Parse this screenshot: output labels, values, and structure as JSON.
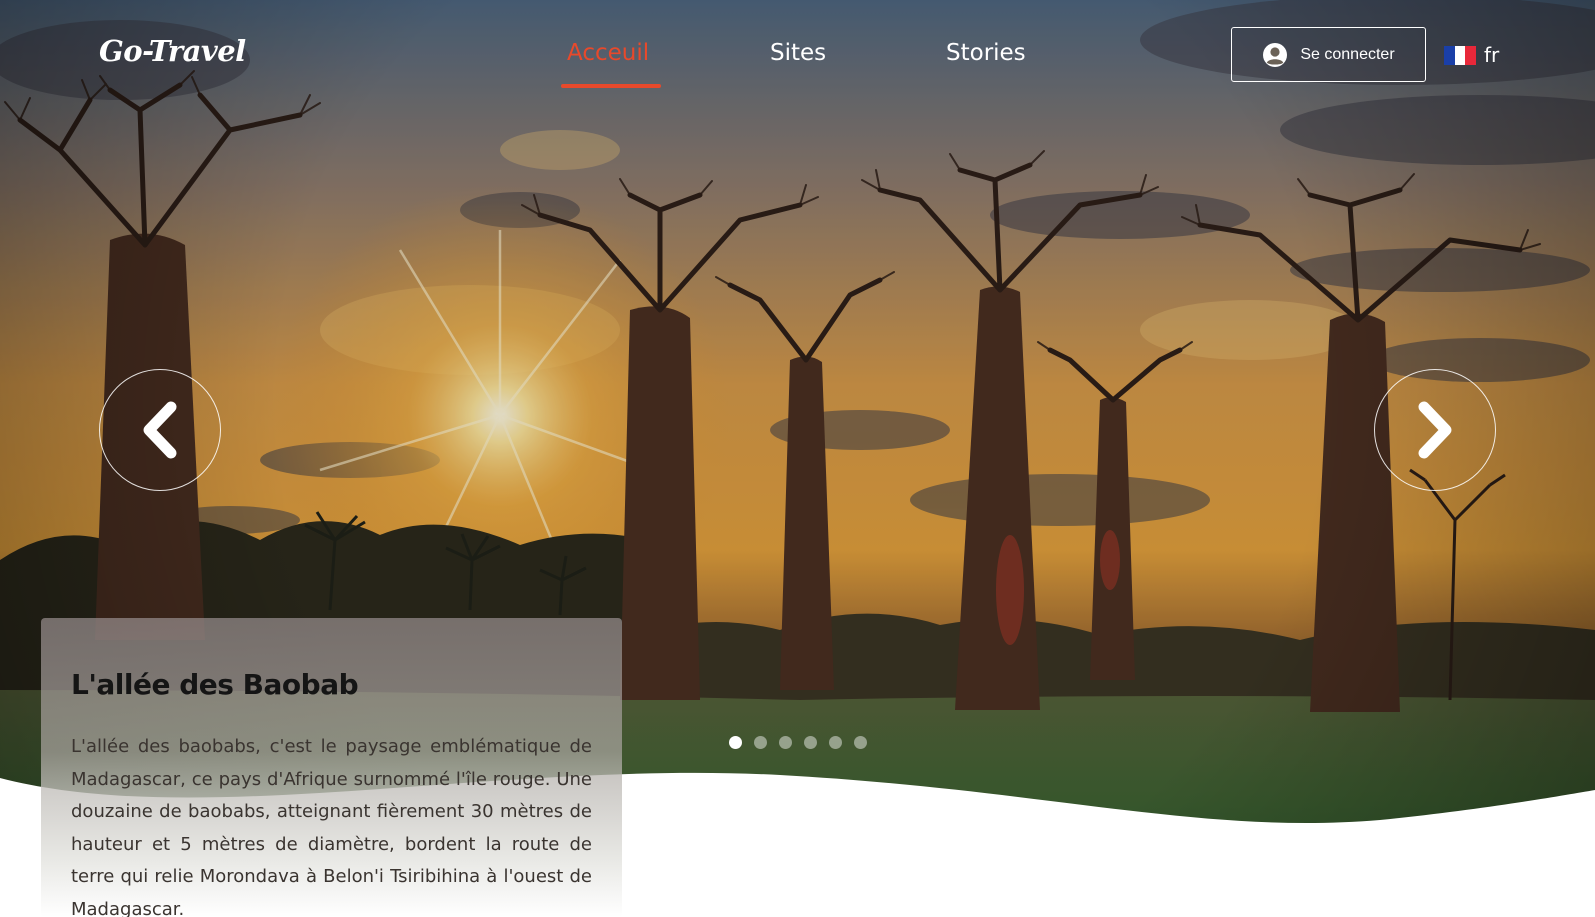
{
  "brand": {
    "logo_text": "Go-Travel"
  },
  "nav": {
    "items": [
      {
        "label": "Acceuil",
        "active": true
      },
      {
        "label": "Sites",
        "active": false
      },
      {
        "label": "Stories",
        "active": false
      }
    ],
    "active_color": "#e8492b"
  },
  "header": {
    "login_label": "Se connecter",
    "login_icon": "user-circle-icon",
    "language": {
      "code": "fr",
      "flag_icon": "france-flag-icon"
    }
  },
  "carousel": {
    "prev_icon": "chevron-left-icon",
    "next_icon": "chevron-right-icon",
    "slide_count": 6,
    "active_index": 0
  },
  "slide": {
    "title": "L'allée des Baobab",
    "description": "L'allée des baobabs, c'est le paysage emblématique de Madagascar, ce pays d'Afrique surnommé l'île rouge. Une douzaine de baobabs, atteignant fièrement 30 mètres de hauteur et 5 mètres de diamètre, bordent la route de terre qui relie Morondava à Belon'i Tsiribihina à l'ouest de Madagascar."
  }
}
